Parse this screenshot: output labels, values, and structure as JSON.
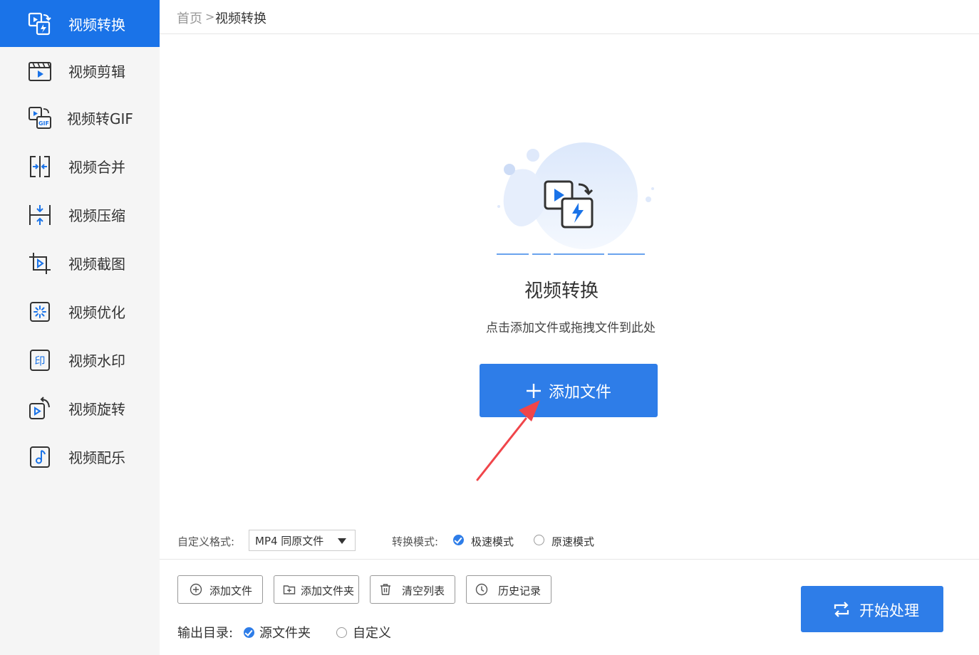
{
  "sidebar": {
    "items": [
      {
        "label": "视频转换",
        "icon": "video-convert-icon"
      },
      {
        "label": "视频剪辑",
        "icon": "video-clip-icon"
      },
      {
        "label": "视频转GIF",
        "icon": "video-to-gif-icon"
      },
      {
        "label": "视频合并",
        "icon": "video-merge-icon"
      },
      {
        "label": "视频压缩",
        "icon": "video-compress-icon"
      },
      {
        "label": "视频截图",
        "icon": "video-screenshot-icon"
      },
      {
        "label": "视频优化",
        "icon": "video-optimize-icon"
      },
      {
        "label": "视频水印",
        "icon": "video-watermark-icon"
      },
      {
        "label": "视频旋转",
        "icon": "video-rotate-icon"
      },
      {
        "label": "视频配乐",
        "icon": "video-music-icon"
      }
    ],
    "active_index": 0,
    "gif_badge": "GIF",
    "watermark_glyph": "印"
  },
  "breadcrumb": {
    "home": "首页",
    "separator": ">",
    "current": "视频转换"
  },
  "dropzone": {
    "title": "视频转换",
    "hint": "点击添加文件或拖拽文件到此处",
    "add_button_label": "添加文件",
    "add_button_icon": "plus-icon"
  },
  "options": {
    "format_label": "自定义格式:",
    "format_value": "MP4 同原文件",
    "mode_label": "转换模式:",
    "mode_options": [
      {
        "label": "极速模式",
        "selected": true
      },
      {
        "label": "原速模式",
        "selected": false
      }
    ]
  },
  "toolbar": {
    "buttons": [
      {
        "label": "添加文件",
        "icon": "add-circle-icon"
      },
      {
        "label": "添加文件夹",
        "icon": "add-folder-icon"
      },
      {
        "label": "清空列表",
        "icon": "trash-icon"
      },
      {
        "label": "历史记录",
        "icon": "clock-icon"
      }
    ]
  },
  "output": {
    "label": "输出目录:",
    "options": [
      {
        "label": "源文件夹",
        "selected": true
      },
      {
        "label": "自定义",
        "selected": false
      }
    ]
  },
  "start_button": {
    "label": "开始处理",
    "icon": "repeat-icon"
  },
  "colors": {
    "accent": "#2e7de8",
    "sidebar_active": "#1a73e8",
    "sidebar_bg": "#f5f5f5",
    "annotation_arrow": "#f0454a"
  }
}
